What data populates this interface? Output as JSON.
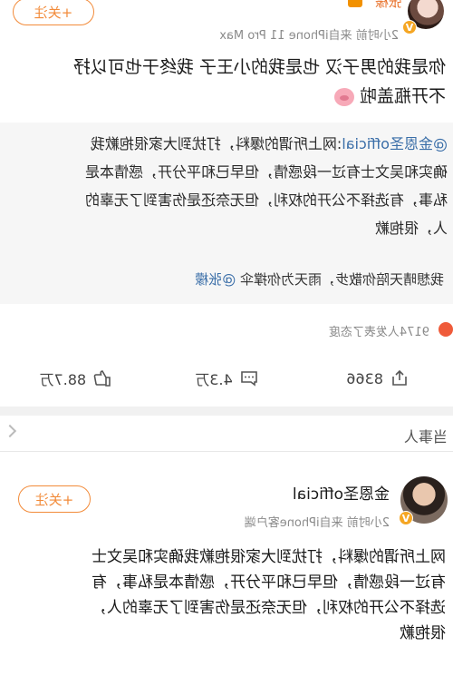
{
  "post1": {
    "author": "张檬",
    "meta": "2小时前 来自iPhone 11 Pro Max",
    "follow_label": "+关注",
    "text_line1": "你是我的男子汉 也是我的小王子 我终于也可以抒",
    "text_line2": "不开瓶盖啦",
    "emoji_icon": "pig-face-icon",
    "quote": {
      "author_link": "@金恩圣official",
      "line1_rest": ":网上所谓的爆料，打扰到大家很抱歉我",
      "line2": "确实和吴文士有过一段感情，但早已和平分开，感情本是",
      "line3": "私事，有选择不公开的权利，但无奈还是伤害到了无辜的",
      "line4": "人，很抱歉",
      "footer_text": "我想晴天陪你散步，雨天为你撑伞",
      "footer_mention": "@张檬"
    },
    "reaction_text": "9174人发表了态度",
    "actions": {
      "share_count": "8366",
      "comment_count": "4.3万",
      "like_count": "88.7万"
    }
  },
  "tag_row": {
    "label": "当事人"
  },
  "post2": {
    "author": "金恩圣official",
    "meta": "2小时前 来自iPhone客户端",
    "follow_label": "+关注",
    "line1": "网上所谓的爆料，打扰到大家很抱歉我确实和吴文士",
    "line2": "有过一段感情，但早已和平分开，感情本是私事，有",
    "line3": "选择不公开的权利，但无奈还是伤害到了无辜的人，",
    "line4": "很抱歉"
  },
  "colors": {
    "accent_orange": "#f28b3a",
    "link_blue": "#3a6ea8",
    "verified_badge": "#f5a623"
  }
}
